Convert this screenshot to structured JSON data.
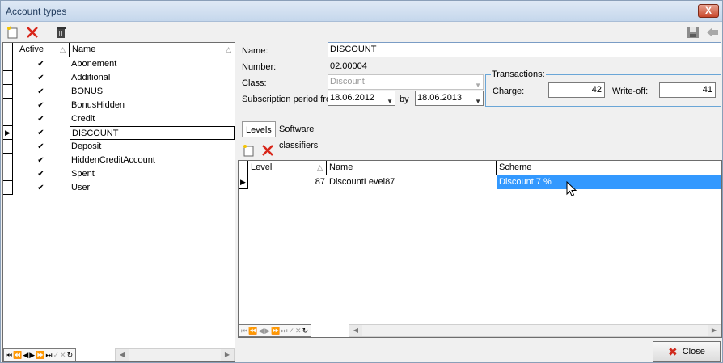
{
  "window": {
    "title": "Account types",
    "close_glyph": "X"
  },
  "toolbar": {
    "icons": [
      "new-record-icon",
      "delete-icon",
      "trash-icon",
      "save-icon",
      "back-icon"
    ]
  },
  "left_grid": {
    "columns": {
      "active": "Active",
      "name": "Name"
    },
    "rows": [
      {
        "name": "Abonement",
        "active": true
      },
      {
        "name": "Additional",
        "active": true
      },
      {
        "name": "BONUS",
        "active": true
      },
      {
        "name": "BonusHidden",
        "active": true
      },
      {
        "name": "Credit",
        "active": true
      },
      {
        "name": "DISCOUNT",
        "active": true,
        "selected": true
      },
      {
        "name": "Deposit",
        "active": true
      },
      {
        "name": "HiddenCreditAccount",
        "active": true
      },
      {
        "name": "Spent",
        "active": true
      },
      {
        "name": "User",
        "active": true
      }
    ]
  },
  "form": {
    "name_label": "Name:",
    "name_value": "DISCOUNT",
    "number_label": "Number:",
    "number_value": "02.00004",
    "class_label": "Class:",
    "class_value": "Discount",
    "period_label": "Subscription period fro",
    "period_from": "18.06.2012",
    "period_by_label": "by",
    "period_to": "18.06.2013",
    "transactions": {
      "title": "Transactions:",
      "charge_label": "Charge:",
      "charge_value": "42",
      "writeoff_label": "Write-off:",
      "writeoff_value": "41"
    }
  },
  "tabs": [
    {
      "label": "Levels",
      "active": true
    },
    {
      "label": "Software classifiers",
      "active": false
    }
  ],
  "levels_grid": {
    "columns": {
      "level": "Level",
      "name": "Name",
      "scheme": "Scheme"
    },
    "rows": [
      {
        "level": "87",
        "name": "DiscountLevel87",
        "scheme": "Discount 7 %"
      }
    ]
  },
  "footer": {
    "close_label": "Close"
  }
}
